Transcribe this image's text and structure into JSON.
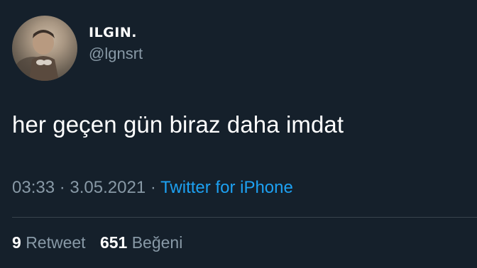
{
  "user": {
    "display_name": "ILGIN.",
    "handle": "@lgnsrt",
    "avatar": "child-photo-avatar"
  },
  "tweet": {
    "text": "her geçen gün biraz daha imdat",
    "time": "03:33",
    "separator": "·",
    "date": "3.05.2021",
    "source": "Twitter for iPhone"
  },
  "stats": {
    "retweet_count": "9",
    "retweet_label": "Retweet",
    "like_count": "651",
    "like_label": "Beğeni"
  },
  "colors": {
    "background": "#15202b",
    "text": "#ffffff",
    "muted": "#8899a6",
    "link": "#1da1f2",
    "divider": "#38444d"
  }
}
